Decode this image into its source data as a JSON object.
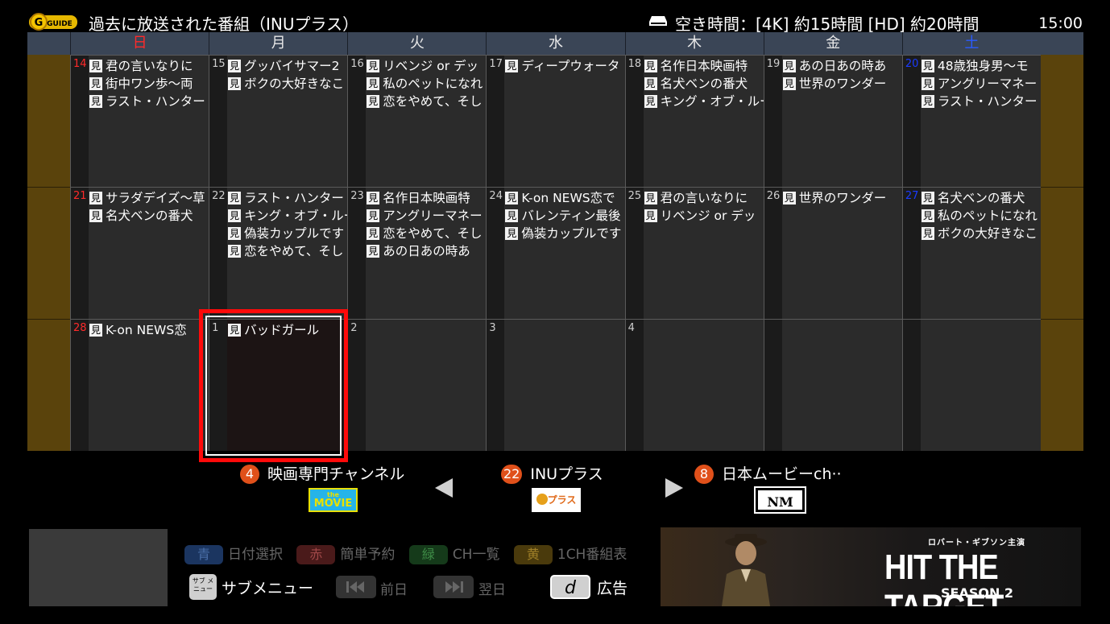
{
  "header": {
    "title": "過去に放送された番組（INUプラス）",
    "free_time": "空き時間：[4K] 約15時間 [HD] 約20時間",
    "clock": "15:00"
  },
  "weekdays": [
    "日",
    "月",
    "火",
    "水",
    "木",
    "金",
    "土"
  ],
  "watched_mark": "見",
  "calendar": {
    "rows": [
      [
        {
          "day": "14",
          "programs": [
            "君の言いなりに",
            "街中ワン歩～両",
            "ラスト・ハンター"
          ]
        },
        {
          "day": "15",
          "programs": [
            "グッバイサマー2",
            "ボクの大好きなこ"
          ]
        },
        {
          "day": "16",
          "programs": [
            "リベンジ or デッ",
            "私のペットになれ",
            "恋をやめて、そし"
          ]
        },
        {
          "day": "17",
          "programs": [
            "ディープウォータ"
          ]
        },
        {
          "day": "18",
          "programs": [
            "名作日本映画特",
            "名犬ベンの番犬",
            "キング・オブ・ルー"
          ]
        },
        {
          "day": "19",
          "programs": [
            "あの日あの時あ",
            "世界のワンダー"
          ]
        },
        {
          "day": "20",
          "programs": [
            "48歳独身男～モ",
            "アングリーマネー",
            "ラスト・ハンター"
          ]
        }
      ],
      [
        {
          "day": "21",
          "programs": [
            "サラダデイズ～草",
            "名犬ベンの番犬"
          ]
        },
        {
          "day": "22",
          "programs": [
            "ラスト・ハンター",
            "キング・オブ・ルー",
            "偽装カップルです",
            "恋をやめて、そし"
          ]
        },
        {
          "day": "23",
          "programs": [
            "名作日本映画特",
            "アングリーマネー",
            "恋をやめて、そし",
            "あの日あの時あ"
          ]
        },
        {
          "day": "24",
          "programs": [
            "K-on NEWS恋で",
            "バレンティン最後",
            "偽装カップルです"
          ]
        },
        {
          "day": "25",
          "programs": [
            "君の言いなりに",
            "リベンジ or デッ"
          ]
        },
        {
          "day": "26",
          "programs": [
            "世界のワンダー"
          ]
        },
        {
          "day": "27",
          "programs": [
            "名犬ベンの番犬",
            "私のペットになれ",
            "ボクの大好きなこ"
          ]
        }
      ],
      [
        {
          "day": "28",
          "programs": [
            "K-on NEWS恋"
          ]
        },
        {
          "day": "1",
          "programs": [
            "バッドガール"
          ],
          "selected": true
        },
        {
          "day": "2",
          "programs": []
        },
        {
          "day": "3",
          "programs": []
        },
        {
          "day": "4",
          "programs": []
        },
        {
          "day": "",
          "programs": []
        },
        {
          "day": "",
          "programs": []
        }
      ]
    ]
  },
  "channels": {
    "prev": {
      "number": "4",
      "name": "映画専門チャンネル",
      "logo_text_small": "the",
      "logo_text": "MOVIE"
    },
    "current": {
      "number": "22",
      "name": "INUプラス",
      "logo_text": "プラス"
    },
    "next": {
      "number": "8",
      "name": "日本ムービーch··",
      "logo_text": "NM"
    }
  },
  "keys": {
    "blue": {
      "label": "青",
      "action": "日付選択"
    },
    "red": {
      "label": "赤",
      "action": "簡単予約"
    },
    "green": {
      "label": "緑",
      "action": "CH一覧"
    },
    "yellow": {
      "label": "黄",
      "action": "1CH番組表"
    },
    "sub": {
      "label": "サブ メニュー",
      "action": "サブメニュー"
    },
    "prev_day": "前日",
    "next_day": "翌日",
    "ad": {
      "label": "d",
      "action": "広告"
    }
  },
  "ad": {
    "subtitle": "ロバート・ギブソン主演",
    "title": "HIT THE TARGET",
    "season": "SEASON 2"
  },
  "colors": {
    "sunday": "#ff2a2a",
    "saturday": "#2a5bff",
    "focus": "#ff0a0a",
    "channel_badge": "#e0501a"
  }
}
